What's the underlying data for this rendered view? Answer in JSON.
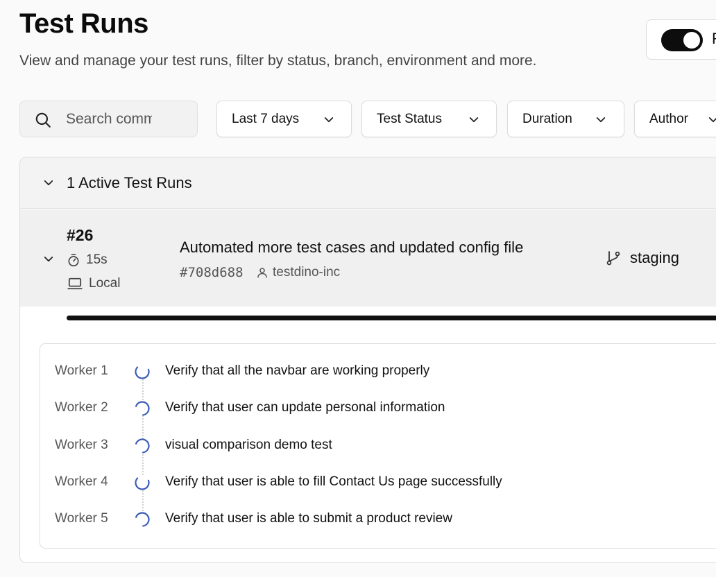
{
  "header": {
    "title": "Test Runs",
    "subtitle": "View and manage your test runs, filter by status, branch, environment and more."
  },
  "toggle": {
    "label": "R",
    "on": true
  },
  "filters": {
    "search_placeholder": "Search commits",
    "date_range": "Last 7 days",
    "test_status": "Test Status",
    "duration": "Duration",
    "author": "Author"
  },
  "active_runs": {
    "header": "1 Active Test Runs",
    "run": {
      "number": "#26",
      "duration": "15s",
      "environment": "Local",
      "commit_message": "Automated more test cases and updated config file",
      "commit_hash": "#708d688",
      "author": "testdino-inc",
      "branch": "staging",
      "progress_percent": 100
    },
    "workers": [
      {
        "label": "Worker 1",
        "test": "Verify that all the navbar are working properly"
      },
      {
        "label": "Worker 2",
        "test": "Verify that user can update personal information"
      },
      {
        "label": "Worker 3",
        "test": "visual comparison demo test"
      },
      {
        "label": "Worker 4",
        "test": "Verify that user is able to fill Contact Us page successfully"
      },
      {
        "label": "Worker 5",
        "test": "Verify that user is able to submit a product review"
      }
    ]
  },
  "colors": {
    "spinner": "#3b5bb5",
    "toggle_bg": "#0d0d0d",
    "progress": "#111111"
  },
  "icons": {
    "search": "search-icon",
    "chevron": "chevron-down-icon",
    "timer": "timer-icon",
    "laptop": "laptop-icon",
    "user": "user-icon",
    "branch": "git-branch-icon",
    "spinner": "spinner-icon"
  }
}
